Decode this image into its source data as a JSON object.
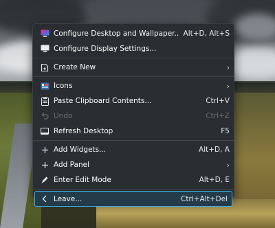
{
  "menu": {
    "items": [
      {
        "label": "Configure Desktop and Wallpaper...",
        "shortcut": "Alt+D, Alt+S",
        "icon": "desktop-color-icon"
      },
      {
        "label": "Configure Display Settings...",
        "shortcut": "",
        "icon": "display-icon"
      },
      {
        "label": "Create New",
        "shortcut": "",
        "icon": "create-new-icon",
        "submenu": true
      },
      {
        "label": "Icons",
        "shortcut": "",
        "icon": "icons-icon",
        "submenu": true
      },
      {
        "label": "Paste Clipboard Contents...",
        "shortcut": "Ctrl+V",
        "icon": "clipboard-icon"
      },
      {
        "label": "Undo",
        "shortcut": "Ctrl+Z",
        "icon": "undo-icon",
        "disabled": true
      },
      {
        "label": "Refresh Desktop",
        "shortcut": "F5",
        "icon": "refresh-desktop-icon"
      },
      {
        "label": "Add Widgets...",
        "shortcut": "Alt+D, A",
        "icon": "plus-icon"
      },
      {
        "label": "Add Panel",
        "shortcut": "",
        "icon": "plus-icon",
        "submenu": true
      },
      {
        "label": "Enter Edit Mode",
        "shortcut": "Alt+D, E",
        "icon": "pencil-icon"
      },
      {
        "label": "Leave...",
        "shortcut": "Ctrl+Alt+Del",
        "icon": "leave-icon",
        "active": true
      }
    ],
    "submenu_arrow": "›"
  },
  "colors": {
    "menu_bg": "#2a2e32",
    "highlight_border": "#3daee9",
    "highlight_bg": "#243b49",
    "text": "#fcfcfc",
    "disabled_text": "#6b6f74"
  }
}
